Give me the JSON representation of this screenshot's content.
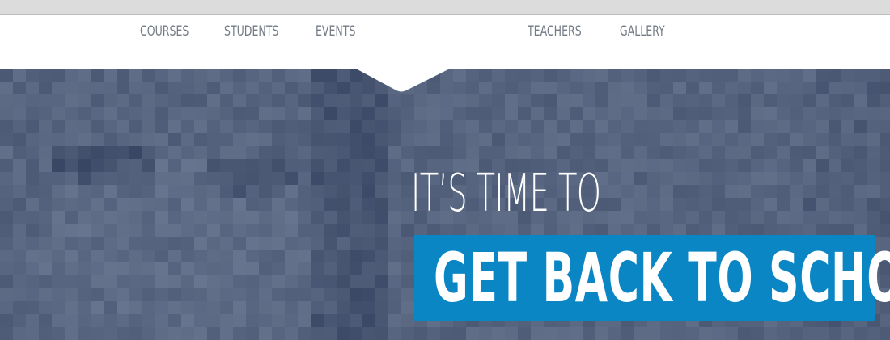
{
  "nav": {
    "items": [
      {
        "label": "COURSES"
      },
      {
        "label": "STUDENTS"
      },
      {
        "label": "EVENTS"
      },
      {
        "label": "TEACHERS"
      },
      {
        "label": "GALLERY"
      }
    ]
  },
  "hero": {
    "line1": "IT’S TIME TO",
    "line2": "GET BACK TO SCHOOL",
    "colors": {
      "background": "#56647f",
      "accent_box": "#0b86c5",
      "nav_text": "#737b86"
    }
  }
}
